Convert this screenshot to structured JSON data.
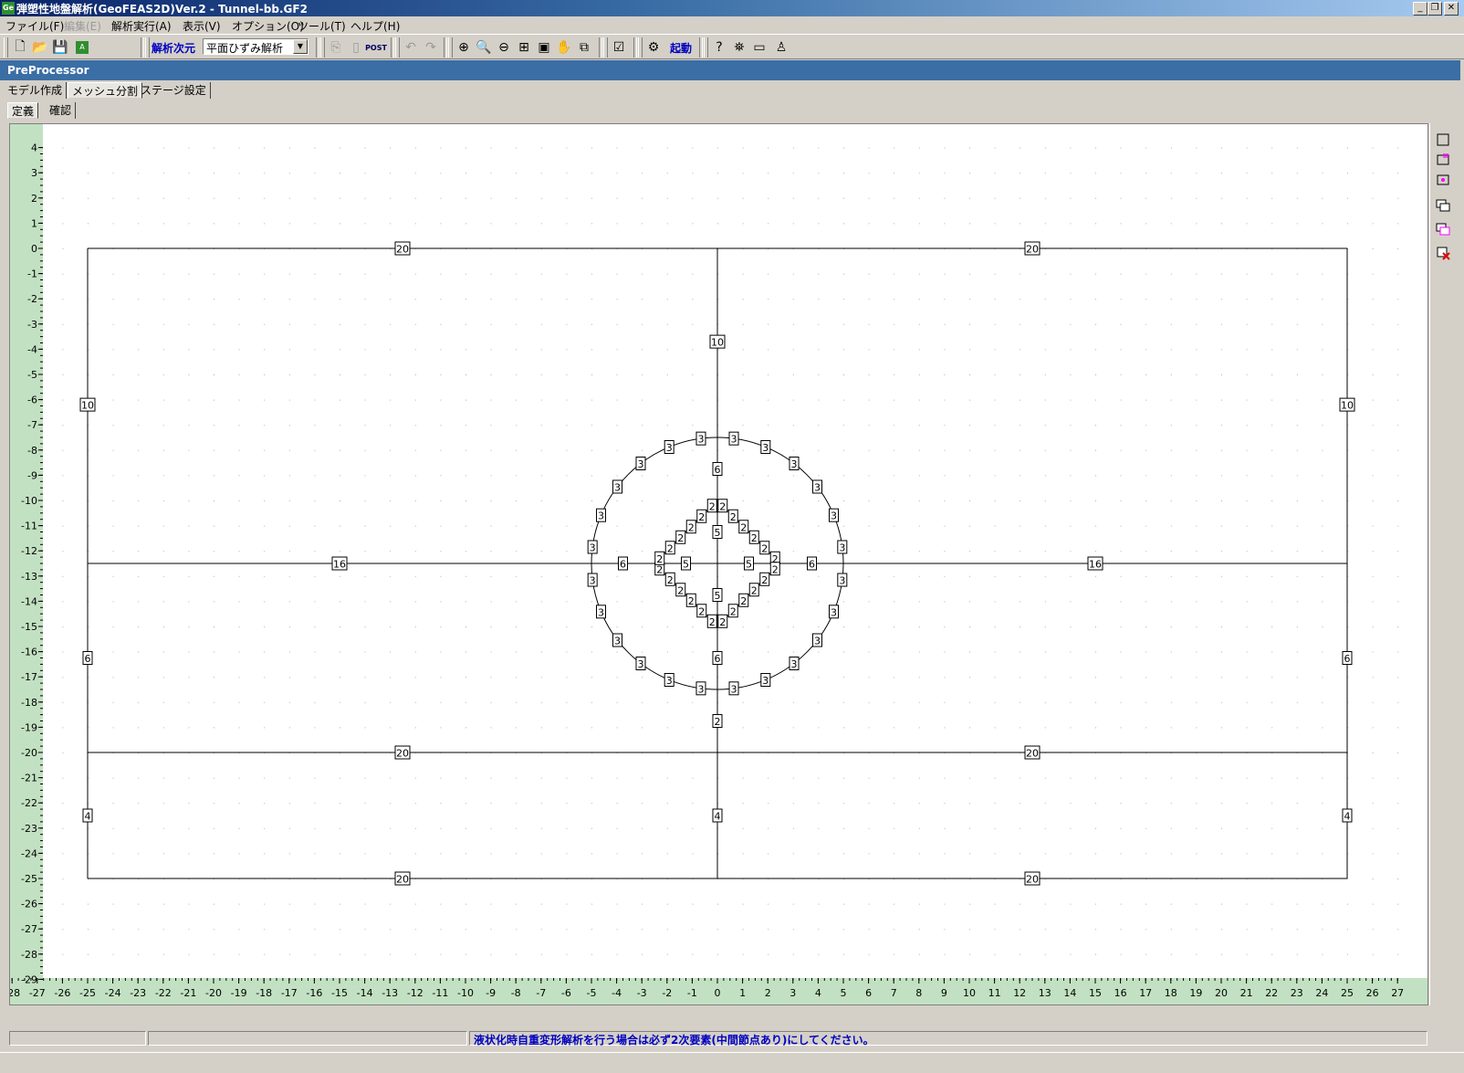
{
  "window": {
    "title": "弾塑性地盤解析(GeoFEAS2D)Ver.2 - Tunnel-bb.GF2",
    "app_icon": "Ge",
    "controls": [
      "_",
      "❐",
      "✕"
    ]
  },
  "menu": [
    {
      "label": "ファイル(F)",
      "enabled": true
    },
    {
      "label": "編集(E)",
      "enabled": false
    },
    {
      "label": "解析実行(A)",
      "enabled": true
    },
    {
      "label": "表示(V)",
      "enabled": true
    },
    {
      "label": "オプション(O)",
      "enabled": true
    },
    {
      "label": "ツール(T)",
      "enabled": true
    },
    {
      "label": "ヘルプ(H)",
      "enabled": true
    }
  ],
  "toolbar": {
    "dimension_label": "解析次元",
    "dimension_value": "平面ひずみ解析",
    "run_label": "起動",
    "post_label": "POST",
    "icons": [
      "new-file-icon",
      "open-folder-icon",
      "save-icon",
      "export-icon",
      "copy-icon",
      "paste-icon",
      "post-icon",
      "undo-icon",
      "redo-icon",
      "zoom-window-icon",
      "zoom-in-icon",
      "zoom-out-icon",
      "fit-all-icon",
      "zoom-frame-icon",
      "pan-hand-icon",
      "redraw-icon",
      "check-model-icon",
      "run-icon",
      "help-icon",
      "about-icon",
      "info-icon",
      "user-icon"
    ]
  },
  "panel": {
    "title": "PreProcessor"
  },
  "tabs": [
    {
      "label": "モデル作成",
      "active": false
    },
    {
      "label": "メッシュ分割",
      "active": true
    },
    {
      "label": "ステージ設定",
      "active": false
    }
  ],
  "subtabs": [
    {
      "label": "定義",
      "active": true
    },
    {
      "label": "確認",
      "active": false
    }
  ],
  "right_tools": [
    "rect-select-icon",
    "rect-add-icon",
    "rect-node-icon",
    "layer-icon",
    "layer-edit-icon",
    "delete-icon"
  ],
  "axes": {
    "x_ticks": [
      "-28",
      "-27",
      "-26",
      "-25",
      "-24",
      "-23",
      "-22",
      "-21",
      "-20",
      "-19",
      "-18",
      "-17",
      "-16",
      "-15",
      "-14",
      "-13",
      "-12",
      "-11",
      "-10",
      "-9",
      "-8",
      "-7",
      "-6",
      "-5",
      "-4",
      "-3",
      "-2",
      "-1",
      "0",
      "1",
      "2",
      "3",
      "4",
      "5",
      "6",
      "7",
      "8",
      "9",
      "10",
      "11",
      "12",
      "13",
      "14",
      "15",
      "16",
      "17",
      "18",
      "19",
      "20",
      "21",
      "22",
      "23",
      "24",
      "25",
      "26",
      "27"
    ],
    "y_ticks": [
      "4",
      "3",
      "2",
      "1",
      "0",
      "-1",
      "-2",
      "-3",
      "-4",
      "-5",
      "-6",
      "-7",
      "-8",
      "-9",
      "-10",
      "-11",
      "-12",
      "-13",
      "-14",
      "-15",
      "-16",
      "-17",
      "-18",
      "-19",
      "-20",
      "-21",
      "-22",
      "-23",
      "-24",
      "-25",
      "-26",
      "-27",
      "-28",
      "-29"
    ]
  },
  "model": {
    "lines": [
      {
        "x1": -25,
        "y1": 0,
        "x2": 25,
        "y2": 0
      },
      {
        "x1": -25,
        "y1": -25,
        "x2": 25,
        "y2": -25
      },
      {
        "x1": -25,
        "y1": 0,
        "x2": -25,
        "y2": -25
      },
      {
        "x1": 25,
        "y1": 0,
        "x2": 25,
        "y2": -25
      },
      {
        "x1": 0,
        "y1": 0,
        "x2": 0,
        "y2": -25
      },
      {
        "x1": -25,
        "y1": -12.5,
        "x2": 25,
        "y2": -12.5
      },
      {
        "x1": -25,
        "y1": -20,
        "x2": 25,
        "y2": -20
      }
    ],
    "circle": {
      "cx": 0,
      "cy": -12.5,
      "r": 5
    },
    "diamond": {
      "cx": 0,
      "cy": -12.5,
      "r": 2.5
    },
    "labels": [
      {
        "x": -12.5,
        "y": 0,
        "t": "20"
      },
      {
        "x": 12.5,
        "y": 0,
        "t": "20"
      },
      {
        "x": 0,
        "y": -3.7,
        "t": "10"
      },
      {
        "x": -25,
        "y": -6.2,
        "t": "10"
      },
      {
        "x": 25,
        "y": -6.2,
        "t": "10"
      },
      {
        "x": -15,
        "y": -12.5,
        "t": "16"
      },
      {
        "x": 15,
        "y": -12.5,
        "t": "16"
      },
      {
        "x": -3.75,
        "y": -12.5,
        "t": "6"
      },
      {
        "x": 3.75,
        "y": -12.5,
        "t": "6"
      },
      {
        "x": 0,
        "y": -8.75,
        "t": "6"
      },
      {
        "x": 0,
        "y": -16.25,
        "t": "6"
      },
      {
        "x": -1.25,
        "y": -12.5,
        "t": "5"
      },
      {
        "x": 1.25,
        "y": -12.5,
        "t": "5"
      },
      {
        "x": 0,
        "y": -11.25,
        "t": "5"
      },
      {
        "x": 0,
        "y": -13.75,
        "t": "5"
      },
      {
        "x": -25,
        "y": -16.25,
        "t": "6"
      },
      {
        "x": 25,
        "y": -16.25,
        "t": "6"
      },
      {
        "x": 0,
        "y": -18.75,
        "t": "2"
      },
      {
        "x": -12.5,
        "y": -20,
        "t": "20"
      },
      {
        "x": 12.5,
        "y": -20,
        "t": "20"
      },
      {
        "x": -25,
        "y": -22.5,
        "t": "4"
      },
      {
        "x": 0,
        "y": -22.5,
        "t": "4"
      },
      {
        "x": 25,
        "y": -22.5,
        "t": "4"
      },
      {
        "x": -12.5,
        "y": -25,
        "t": "20"
      },
      {
        "x": 12.5,
        "y": -25,
        "t": "20"
      }
    ],
    "circle_label": "3",
    "circle_label_count": 24,
    "diamond_label": "2",
    "diamond_label_count": 24
  },
  "status": {
    "message": "液状化時自重変形解析を行う場合は必ず2次要素(中間節点あり)にしてください。"
  }
}
